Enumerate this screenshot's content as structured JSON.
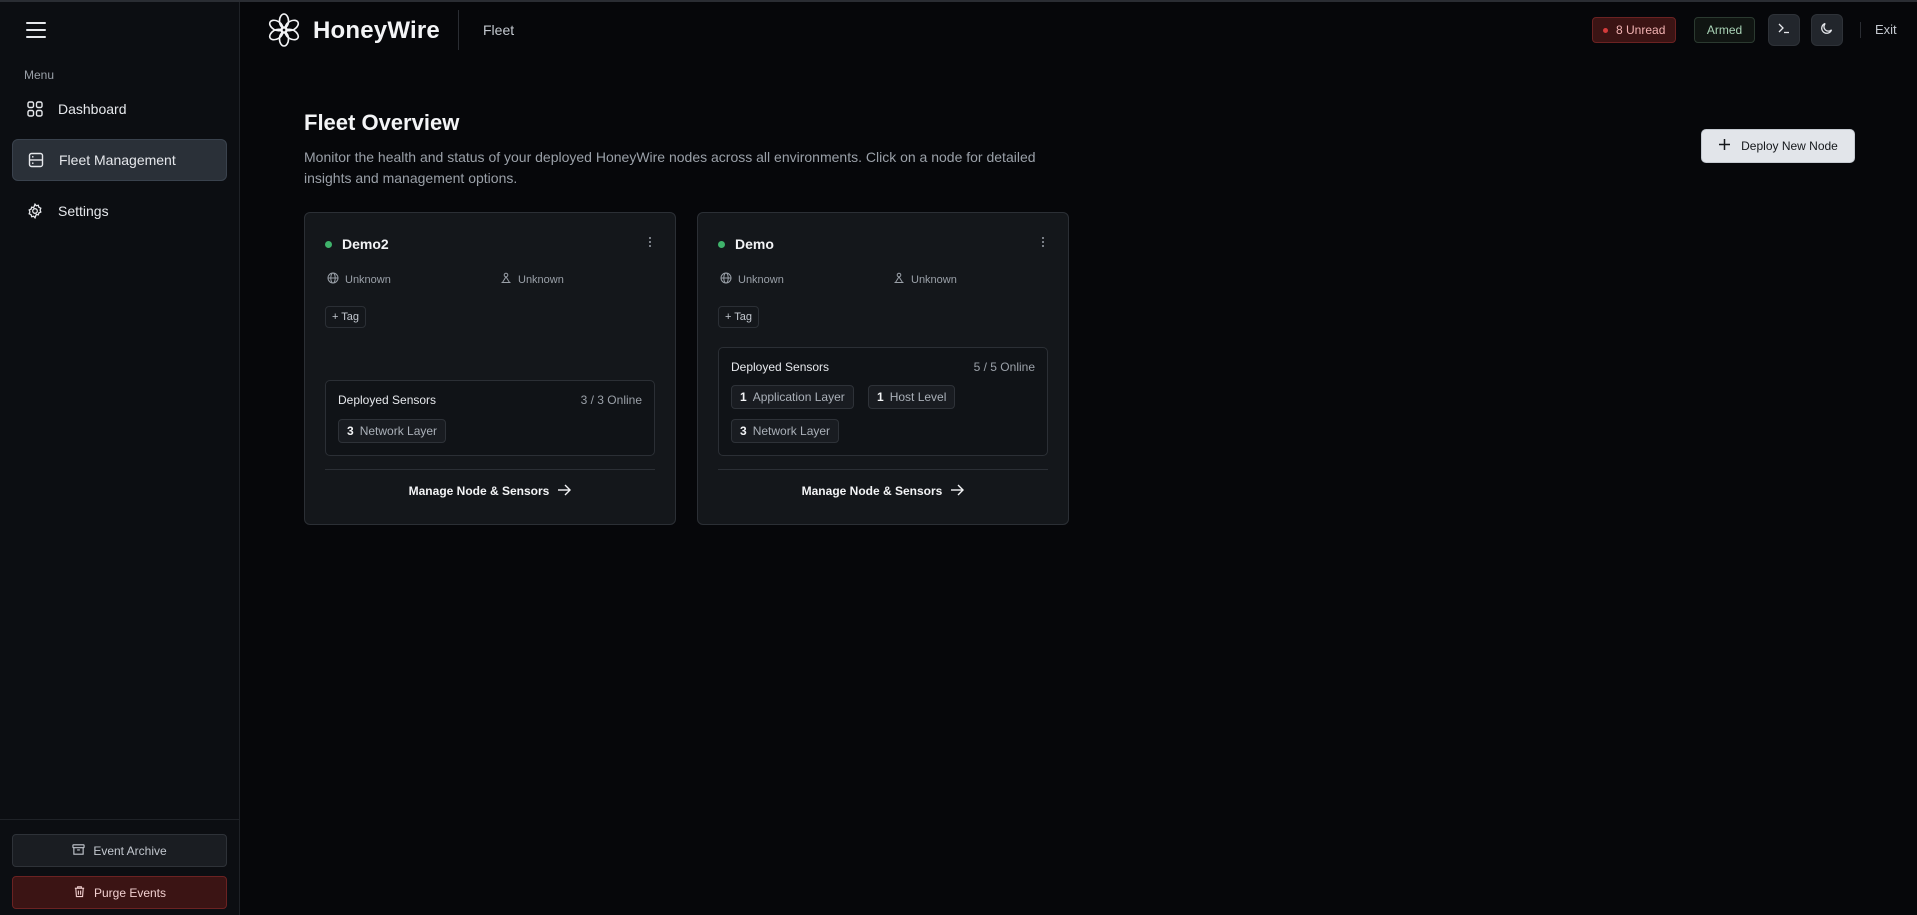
{
  "app": {
    "title": "HoneyWire",
    "page_label": "Fleet"
  },
  "sidebar": {
    "menu_caption": "Menu",
    "items": [
      {
        "label": "Dashboard",
        "icon": "grid-icon",
        "active": false
      },
      {
        "label": "Fleet Management",
        "icon": "server-icon",
        "active": true
      },
      {
        "label": "Settings",
        "icon": "gear-icon",
        "active": false
      }
    ],
    "archive_label": "Event Archive",
    "purge_label": "Purge Events"
  },
  "header": {
    "unread_label": "8 Unread",
    "armed_label": "Armed",
    "exit_label": "Exit"
  },
  "main": {
    "title": "Fleet Overview",
    "description": "Monitor the health and status of your deployed HoneyWire nodes across all environments. Click on a node for detailed insights and management options.",
    "deploy_label": "Deploy New Node"
  },
  "nodes": [
    {
      "name": "Demo2",
      "status_color": "#3fb36b",
      "location": "Unknown",
      "owner": "Unknown",
      "tag_label": "+ Tag",
      "sensors_title": "Deployed Sensors",
      "sensors_online": "3 / 3 Online",
      "chips": [
        {
          "count": "3",
          "label": "Network Layer"
        }
      ],
      "manage_label": "Manage Node & Sensors"
    },
    {
      "name": "Demo",
      "status_color": "#3fb36b",
      "location": "Unknown",
      "owner": "Unknown",
      "tag_label": "+ Tag",
      "sensors_title": "Deployed Sensors",
      "sensors_online": "5 / 5 Online",
      "chips": [
        {
          "count": "1",
          "label": "Application Layer"
        },
        {
          "count": "1",
          "label": "Host Level"
        },
        {
          "count": "3",
          "label": "Network Layer"
        }
      ],
      "manage_label": "Manage Node & Sensors"
    }
  ]
}
